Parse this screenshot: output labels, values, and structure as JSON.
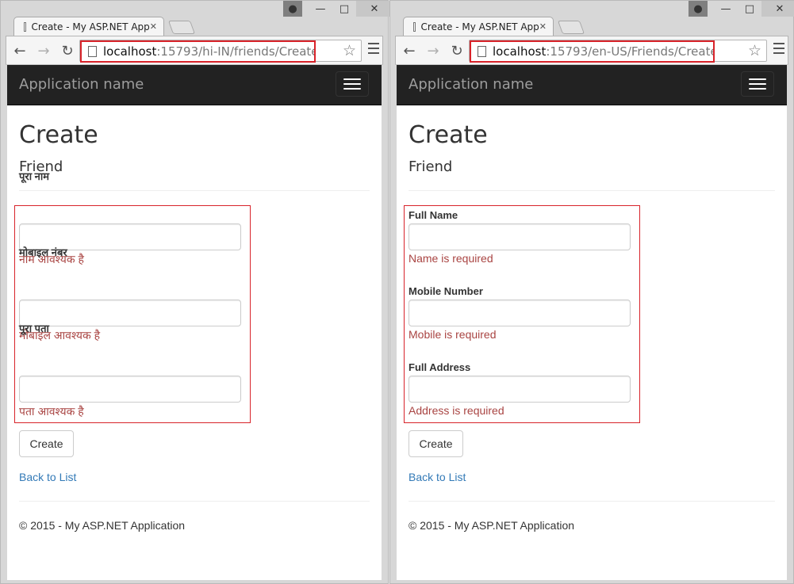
{
  "left": {
    "tab_title": "Create - My ASP.NET App",
    "url_host": "localhost",
    "url_rest": ":15793/hi-IN/friends/Create",
    "brand": "Application name",
    "heading": "Create",
    "subheading": "Friend",
    "fields": [
      {
        "label": "पूरा नाम",
        "value": "",
        "error": "नाम आवश्यक है"
      },
      {
        "label": "मोबाइल नंबर",
        "value": "",
        "error": "मोबाइल आवश्यक है"
      },
      {
        "label": "पूरा पता",
        "value": "",
        "error": "पता आवश्यक है"
      }
    ],
    "create_button": "Create",
    "back_link": "Back to List",
    "footer": "© 2015 - My ASP.NET Application"
  },
  "right": {
    "tab_title": "Create - My ASP.NET App",
    "url_host": "localhost",
    "url_rest": ":15793/en-US/Friends/Create",
    "brand": "Application name",
    "heading": "Create",
    "subheading": "Friend",
    "fields": [
      {
        "label": "Full Name",
        "value": "",
        "error": "Name is required"
      },
      {
        "label": "Mobile Number",
        "value": "",
        "error": "Mobile is required"
      },
      {
        "label": "Full Address",
        "value": "",
        "error": "Address is required"
      }
    ],
    "create_button": "Create",
    "back_link": "Back to List",
    "footer": "© 2015 - My ASP.NET Application"
  },
  "icons": {
    "back": "arrow-left-icon",
    "forward": "arrow-right-icon",
    "reload": "reload-icon",
    "bookmark": "star-icon",
    "menu": "hamburger-icon",
    "close": "close-icon",
    "user": "user-icon"
  },
  "colors": {
    "navbar": "#222222",
    "error": "#a94442",
    "link": "#337ab7",
    "highlight": "#d8232a"
  }
}
